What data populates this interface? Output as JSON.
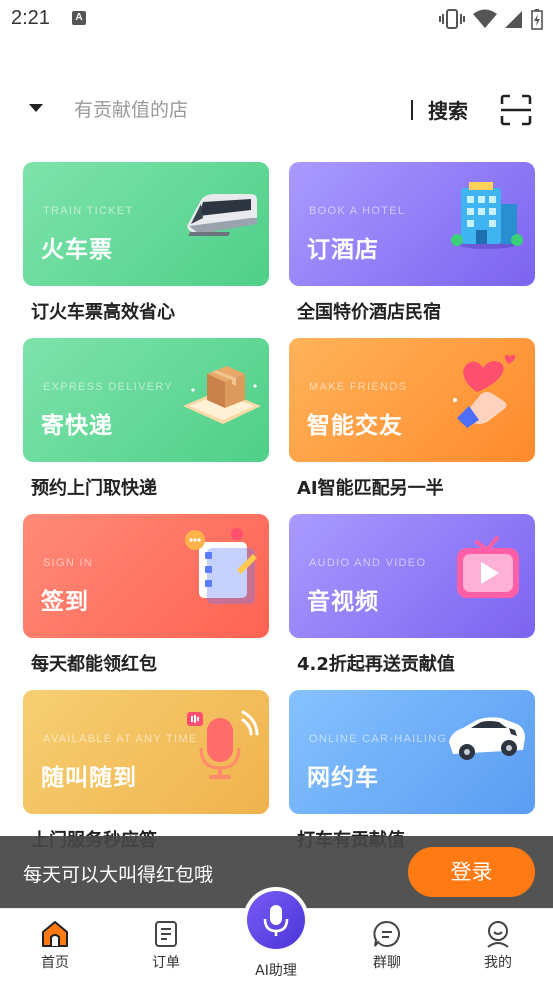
{
  "status_bar": {
    "time": "2:21",
    "notification_letter": "A"
  },
  "search": {
    "placeholder": "有贡献值的店",
    "button_label": "搜索"
  },
  "services": [
    {
      "title": "火车票",
      "subtitle": "TRAIN TICKET",
      "caption": "订火车票高效省心",
      "icon": "train-icon",
      "color": "#5ed495"
    },
    {
      "title": "订酒店",
      "subtitle": "BOOK A HOTEL",
      "caption": "全国特价酒店民宿",
      "icon": "hotel-icon",
      "color": "#8f7bf8"
    },
    {
      "title": "寄快递",
      "subtitle": "EXPRESS DELIVERY",
      "caption": "预约上门取快递",
      "icon": "package-icon",
      "color": "#5ed495"
    },
    {
      "title": "智能交友",
      "subtitle": "MAKE FRIENDS",
      "caption": "AI智能匹配另一半",
      "icon": "heart-hand-icon",
      "color": "#ff9b3c"
    },
    {
      "title": "签到",
      "subtitle": "SIGN IN",
      "caption": "每天都能领红包",
      "icon": "checklist-icon",
      "color": "#ff7262"
    },
    {
      "title": "音视频",
      "subtitle": "AUDIO AND VIDEO",
      "caption": "4.2折起再送贡献值",
      "icon": "tv-play-icon",
      "color": "#8f7bf8"
    },
    {
      "title": "随叫随到",
      "subtitle": "AVAILABLE AT ANY TIME",
      "caption": "上门服务秒应答",
      "icon": "microphone-icon",
      "color": "#f3c05f"
    },
    {
      "title": "网约车",
      "subtitle": "ONLINE CAR-HAILING",
      "caption": "打车有贡献值",
      "icon": "car-icon",
      "color": "#6fb0fa"
    }
  ],
  "banner": {
    "text": "每天可以大叫得红包哦",
    "login_label": "登录",
    "accent": "#ff7a12"
  },
  "nav": {
    "home": "首页",
    "orders": "订单",
    "ai": "AI助理",
    "chat": "群聊",
    "mine": "我的"
  }
}
